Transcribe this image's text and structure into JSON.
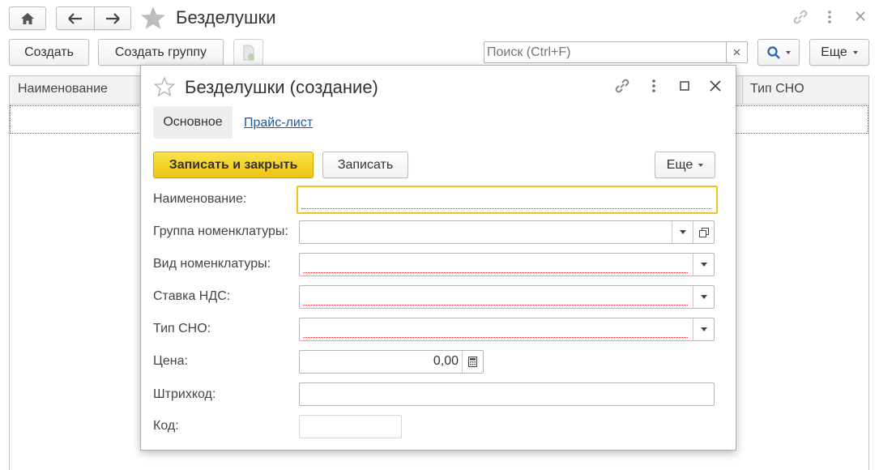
{
  "main": {
    "title": "Безделушки",
    "create_label": "Создать",
    "create_group_label": "Создать группу",
    "search_placeholder": "Поиск (Ctrl+F)",
    "search_clear": "×",
    "more_label": "Еще",
    "columns": [
      "Наименование",
      "Тип СНО"
    ]
  },
  "dialog": {
    "title": "Безделушки (создание)",
    "tabs": [
      "Основное",
      "Прайс-лист"
    ],
    "save_close_label": "Записать и закрыть",
    "save_label": "Записать",
    "more_label": "Еще",
    "fields": {
      "name_label": "Наименование:",
      "group_label": "Группа номенклатуры:",
      "kind_label": "Вид номенклатуры:",
      "vat_label": "Ставка НДС:",
      "tax_label": "Тип СНО:",
      "price_label": "Цена:",
      "price_value": "0,00",
      "barcode_label": "Штрихкод:",
      "code_label": "Код:"
    }
  },
  "colors": {
    "accent_yellow": "#f5d31c",
    "focus_border": "#f0c419",
    "required_line": "#d33333",
    "link": "#1a5a9e"
  }
}
